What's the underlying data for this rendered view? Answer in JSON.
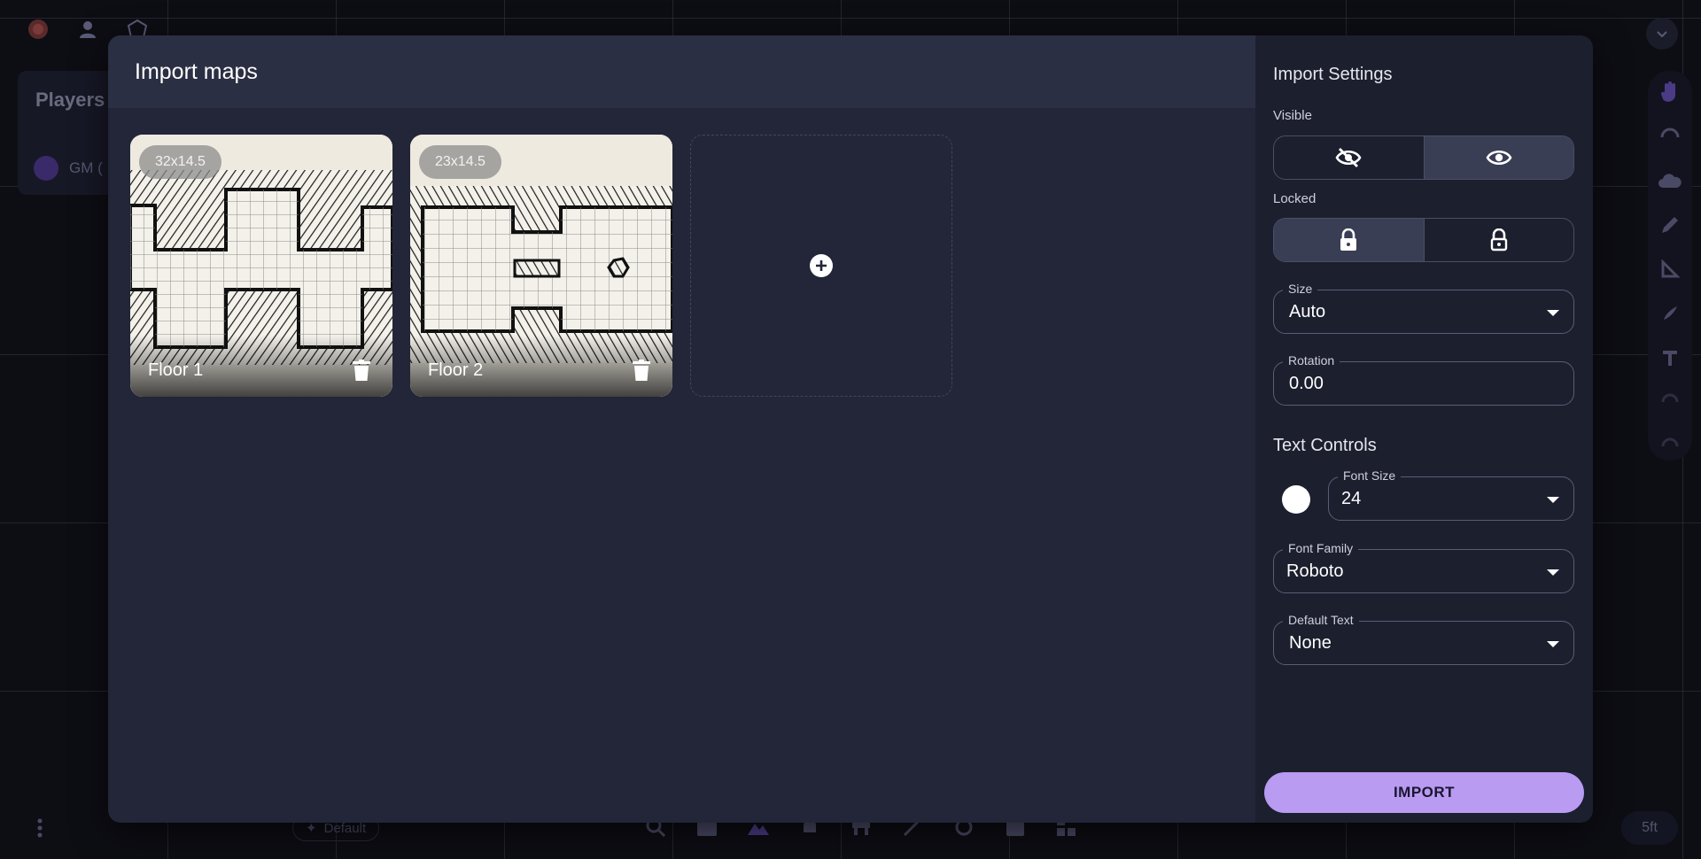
{
  "background": {
    "players_title": "Players",
    "gm_label": "GM (",
    "layer_chip": "Default",
    "scale_label": "5ft"
  },
  "modal": {
    "title": "Import maps",
    "maps": [
      {
        "name": "Floor 1",
        "size": "32x14.5"
      },
      {
        "name": "Floor 2",
        "size": "23x14.5"
      }
    ],
    "add_icon": "plus-circle-icon"
  },
  "settings": {
    "title": "Import Settings",
    "visible": {
      "label": "Visible",
      "options": [
        "hidden-eye-icon",
        "eye-icon"
      ],
      "selected": "eye-icon"
    },
    "locked": {
      "label": "Locked",
      "options": [
        "lock-icon",
        "unlock-icon"
      ],
      "selected": "lock-icon"
    },
    "size": {
      "label": "Size",
      "value": "Auto"
    },
    "rotation": {
      "label": "Rotation",
      "value": "0.00"
    },
    "text_controls": {
      "title": "Text Controls",
      "color": "#ffffff",
      "font_size": {
        "label": "Font Size",
        "value": "24"
      },
      "font_family": {
        "label": "Font Family",
        "value": "Roboto"
      },
      "default_text": {
        "label": "Default Text",
        "value": "None"
      }
    },
    "import_label": "IMPORT"
  },
  "colors": {
    "accent": "#b99bf2",
    "modal_bg": "#222638",
    "side_bg": "#1c1f2e"
  }
}
